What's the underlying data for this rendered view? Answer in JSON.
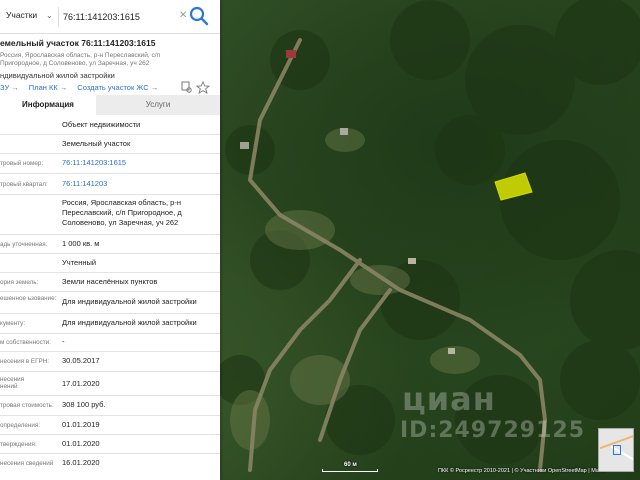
{
  "search": {
    "type_label": "Участки",
    "query": "76:11:141203:1615"
  },
  "object": {
    "title": "емельный участок 76:11:141203:1615",
    "address_short": "Россия, Ярославская область, р-н Переславский, с/п Пригородное, д Соловеново, ул Заречная, уч 262",
    "purpose": "ндивидуальной жилой застройки"
  },
  "links": [
    {
      "label": "ЗУ →"
    },
    {
      "label": "План КК →"
    },
    {
      "label": "Создать участок ЖС →"
    }
  ],
  "tabs": {
    "info": "Информация",
    "services": "Услуги"
  },
  "rows": [
    {
      "label": "",
      "value": "Объект недвижимости"
    },
    {
      "label": "",
      "value": "Земельный участок"
    },
    {
      "label": "тровый номер:",
      "value": "76:11:141203:1615"
    },
    {
      "label": "тровый квартал:",
      "value": "76:11:141203"
    },
    {
      "label": "",
      "value": "Россия, Ярославская область, р-н Переславский, с/п Пригородное, д Соловеново, ул Заречная, уч 262"
    },
    {
      "label": "адь уточненная:",
      "value": "1 000 кв. м"
    },
    {
      "label": "",
      "value": "Учтенный"
    },
    {
      "label": "ория земель:",
      "value": "Земли населённых пунктов"
    },
    {
      "label": "ешенное ьзование:",
      "value": "Для индивидуальной жилой застройки"
    },
    {
      "label": "кументу:",
      "value": "Для индивидуальной жилой застройки"
    },
    {
      "label": "м собственности:",
      "value": "-"
    },
    {
      "label": "несения в ЕГРН:",
      "value": "30.05.2017"
    },
    {
      "label": "несения нений",
      "value": "17.01.2020"
    },
    {
      "label": "тровая стоимость:",
      "value": "308 100 руб."
    },
    {
      "label": "определения:",
      "value": "01.01.2019"
    },
    {
      "label": "тверждения:",
      "value": "01.01.2020"
    },
    {
      "label": "несения сведений",
      "value": "16.01.2020"
    }
  ],
  "map": {
    "scale_label": "60 м",
    "attribution": "ПКК © Росреестр 2010-2021 | © Участники OpenStreetMap | Масш",
    "watermark_brand": "циан",
    "watermark_id": "ID:249729125",
    "parcel_color": "#e8f000",
    "road_color": "#8a8464"
  },
  "colors": {
    "link": "#2a6fd0",
    "search_button": "#2c78d6"
  }
}
